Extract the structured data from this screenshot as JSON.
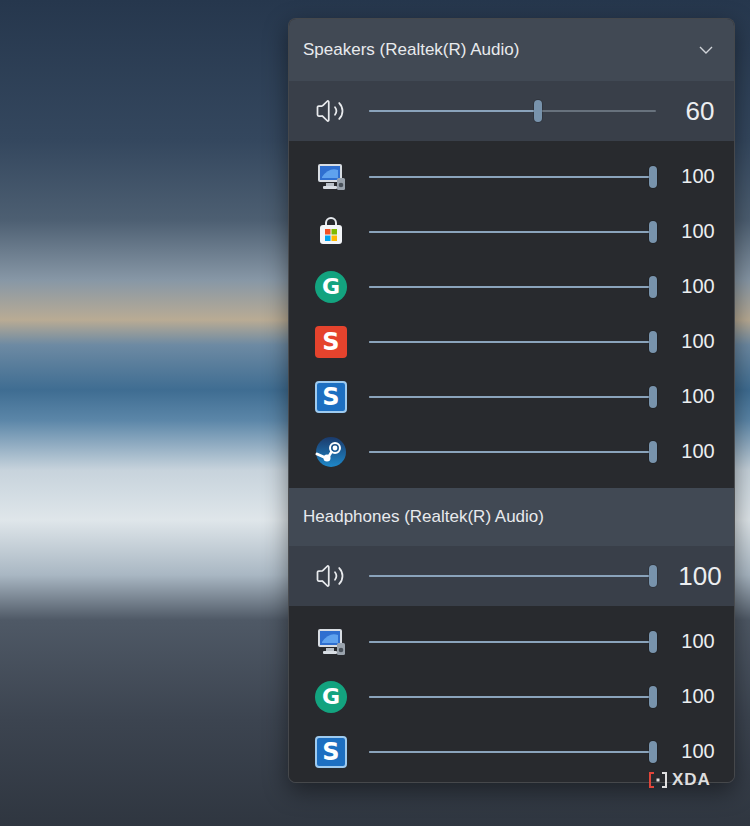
{
  "devices": [
    {
      "name": "Speakers (Realtek(R) Audio)",
      "dropdown": true,
      "master": {
        "level": 0.6,
        "reading": "60"
      },
      "apps": [
        {
          "kind": "system",
          "level": 1,
          "reading": "100"
        },
        {
          "kind": "store",
          "level": 1,
          "reading": "100"
        },
        {
          "kind": "grammarly",
          "badge": "G",
          "level": 1,
          "reading": "100"
        },
        {
          "kind": "editor",
          "badge": "S",
          "level": 1,
          "reading": "100"
        },
        {
          "kind": "snagit",
          "badge": "S",
          "level": 1,
          "reading": "100"
        },
        {
          "kind": "steam",
          "level": 1,
          "reading": "100"
        }
      ]
    },
    {
      "name": "Headphones (Realtek(R) Audio)",
      "dropdown": false,
      "master": {
        "level": 1,
        "reading": "100"
      },
      "apps": [
        {
          "kind": "system",
          "level": 1,
          "reading": "100"
        },
        {
          "kind": "grammarly",
          "badge": "G",
          "level": 1,
          "reading": "100"
        },
        {
          "kind": "snagit",
          "badge": "S",
          "level": 1,
          "reading": "100"
        }
      ]
    }
  ],
  "watermark": "XDA"
}
